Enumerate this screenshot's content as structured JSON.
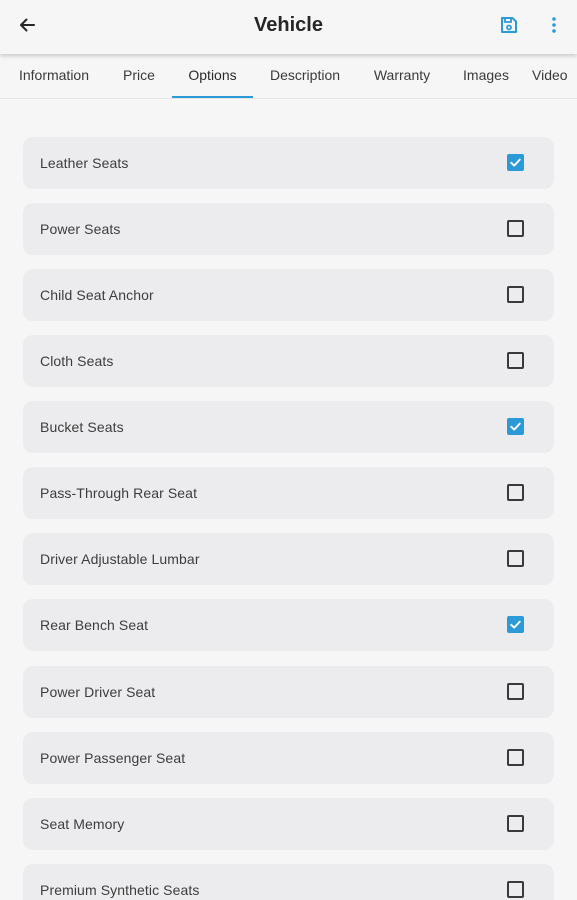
{
  "header": {
    "title": "Vehicle",
    "back_icon": "arrow-left-icon",
    "save_icon": "floppy-disk-icon",
    "more_icon": "more-vertical-icon",
    "accent_color": "#2c9ad6"
  },
  "tabs": [
    {
      "label": "Information",
      "active": false
    },
    {
      "label": "Price",
      "active": false
    },
    {
      "label": "Options",
      "active": true
    },
    {
      "label": "Description",
      "active": false
    },
    {
      "label": "Warranty",
      "active": false
    },
    {
      "label": "Images",
      "active": false
    },
    {
      "label": "Video",
      "active": false
    }
  ],
  "options": [
    {
      "label": "Leather Seats",
      "checked": true
    },
    {
      "label": "Power Seats",
      "checked": false
    },
    {
      "label": "Child Seat Anchor",
      "checked": false
    },
    {
      "label": "Cloth Seats",
      "checked": false
    },
    {
      "label": "Bucket Seats",
      "checked": true
    },
    {
      "label": "Pass-Through Rear Seat",
      "checked": false
    },
    {
      "label": "Driver Adjustable Lumbar",
      "checked": false
    },
    {
      "label": "Rear Bench Seat",
      "checked": true
    },
    {
      "label": "Power Driver Seat",
      "checked": false
    },
    {
      "label": "Power Passenger Seat",
      "checked": false
    },
    {
      "label": "Seat Memory",
      "checked": false
    },
    {
      "label": "Premium Synthetic Seats",
      "checked": false
    }
  ]
}
